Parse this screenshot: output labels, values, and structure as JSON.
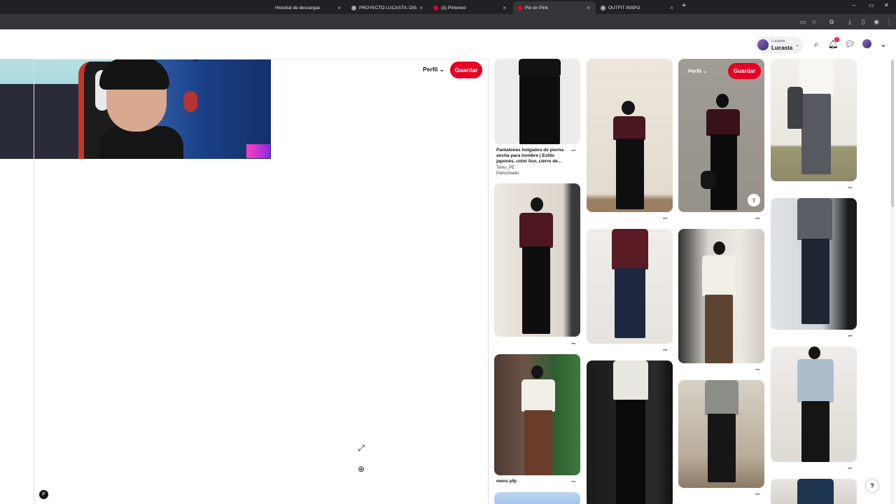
{
  "browser": {
    "tabs": [
      {
        "title": "Historial de descargas",
        "active": false
      },
      {
        "title": "PROYECTO LUCASTA: DISEÑO",
        "active": false
      },
      {
        "title": "(3) Pinterest",
        "active": false
      },
      {
        "title": "Pin en Pink",
        "active": true
      },
      {
        "title": "OUTFIT INSPO",
        "active": false
      }
    ],
    "new_tab": "+",
    "window_controls": [
      "–",
      "▭",
      "✕"
    ]
  },
  "header": {
    "account_label": "Lucasta",
    "account_name": "Lucasta",
    "notification_count": "2"
  },
  "closeup": {
    "profile_label": "Perfil",
    "save_label": "Guardar"
  },
  "pins": {
    "sponsored": {
      "title": "Pantalones holgados de pierna ancha para hombre | Estilo japonés, color liso, cierre de...",
      "advertiser": "Temu_PE",
      "tag": "Patrocinado"
    },
    "mens_pfp": {
      "title": "mens pfp"
    },
    "hover": {
      "profile_label": "Perfil",
      "save_label": "Guardar"
    },
    "more": "···"
  },
  "colors": {
    "brand_red": "#e60023",
    "tab_bg": "#202124",
    "toolbar_bg": "#35363a"
  }
}
